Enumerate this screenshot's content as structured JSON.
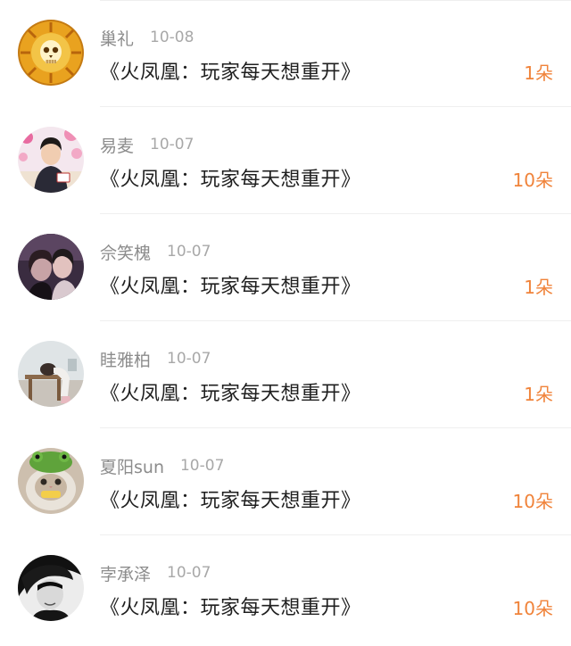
{
  "accent_color": "#f0833a",
  "entries": [
    {
      "user": "巢礼",
      "date": "10-08",
      "title": "《火凤凰：玩家每天想重开》",
      "gift": "1朵",
      "avatar_icon": "golden-lion-skull-avatar"
    },
    {
      "user": "易麦",
      "date": "10-07",
      "title": "《火凤凰：玩家每天想重开》",
      "gift": "10朵",
      "avatar_icon": "boy-photo-avatar"
    },
    {
      "user": "佘笑槐",
      "date": "10-07",
      "title": "《火凤凰：玩家每天想重开》",
      "gift": "1朵",
      "avatar_icon": "couple-photo-avatar"
    },
    {
      "user": "眭雅柏",
      "date": "10-07",
      "title": "《火凤凰：玩家每天想重开》",
      "gift": "1朵",
      "avatar_icon": "girl-at-desk-avatar"
    },
    {
      "user": "夏阳sun",
      "date": "10-07",
      "title": "《火凤凰：玩家每天想重开》",
      "gift": "10朵",
      "avatar_icon": "cat-with-frog-hat-avatar"
    },
    {
      "user": "孛承泽",
      "date": "10-07",
      "title": "《火凤凰：玩家每天想重开》",
      "gift": "10朵",
      "avatar_icon": "black-white-portrait-avatar"
    }
  ]
}
